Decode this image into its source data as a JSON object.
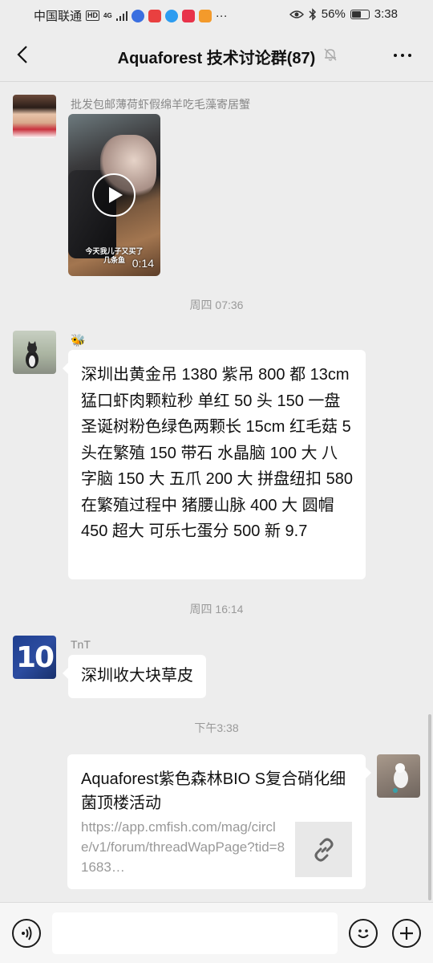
{
  "status_bar": {
    "carrier": "中国联通",
    "hd": "HD",
    "network": "4G",
    "battery": "56%",
    "battery_level": 0.56,
    "time": "3:38",
    "more": "···"
  },
  "header": {
    "title": "Aquaforest 技术讨论群(87)"
  },
  "messages": {
    "m1": {
      "sender": "批发包邮薄荷虾假绵羊吃毛藻寄居蟹",
      "video_caption": "今天我儿子又买了\n几条鱼",
      "video_duration": "0:14"
    },
    "t1": "周四 07:36",
    "m2": {
      "sender_emoji": "🐝",
      "text": "深圳出黄金吊 1380 紫吊 800 都 13cm 猛口虾肉颗粒秒 单红 50 头 150 一盘 圣诞树粉色绿色两颗长 15cm  红毛菇 5 头在繁殖 150 带石 水晶脑 100 大 八字脑 150 大 五爪 200 大 拼盘纽扣 580 在繁殖过程中 猪腰山脉 400 大 圆帽 450 超大 可乐七蛋分 500 新 9.7"
    },
    "t2": "周四 16:14",
    "m3": {
      "sender": "TnT",
      "avatar_text": "10",
      "text": "深圳收大块草皮"
    },
    "t3": "下午3:38",
    "m4": {
      "link_title": "Aquaforest紫色森林BIO S复合硝化细菌顶楼活动",
      "link_url": "https://app.cmfish.com/mag/circle/v1/forum/threadWapPage?tid=81683…"
    }
  },
  "colors": {
    "background": "#ededed",
    "bubble": "#ffffff",
    "timestamp": "#999999",
    "sender": "#888888"
  }
}
